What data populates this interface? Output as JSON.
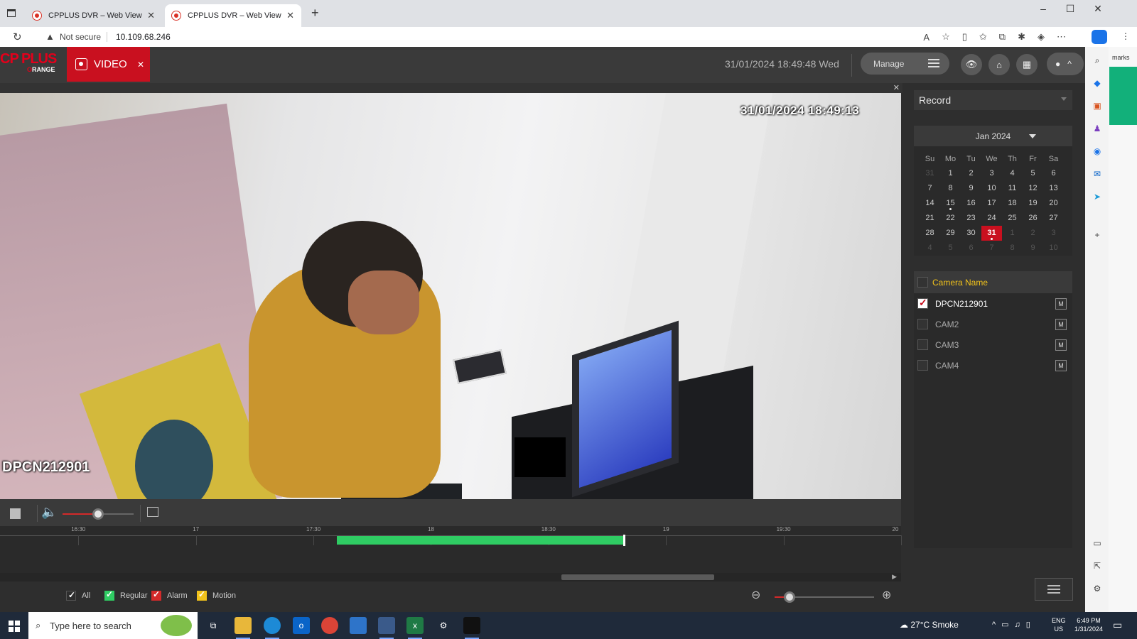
{
  "browser": {
    "tabs": [
      {
        "title": "CPPLUS DVR – Web View",
        "active": false
      },
      {
        "title": "CPPLUS DVR – Web View",
        "active": true
      }
    ],
    "security_label": "Not secure",
    "url": "10.109.68.246"
  },
  "app": {
    "brand": "CP PLUS",
    "sub_brand": "RANGE",
    "video_tab": "VIDEO",
    "datetime": "31/01/2024 18:49:48 Wed",
    "manage": "Manage"
  },
  "video": {
    "osd_timestamp": "31/01/2024 18:49:13",
    "osd_camera": "DPCN212901"
  },
  "playback": {
    "volume_level": 0.5,
    "timeline_ticks": [
      "16:30",
      "17",
      "17:30",
      "18",
      "18:30",
      "19",
      "19:30",
      "20"
    ],
    "record_range": [
      "17:36",
      "18:49"
    ],
    "cursor_time": "18:49",
    "legend": {
      "all": "All",
      "regular": "Regular",
      "alarm": "Alarm",
      "motion": "Motion"
    },
    "zoom_level": 0.15
  },
  "side": {
    "record_type": "Record",
    "calendar": {
      "month_label": "Jan 2024",
      "weekdays": [
        "Su",
        "Mo",
        "Tu",
        "We",
        "Th",
        "Fr",
        "Sa"
      ],
      "days": [
        [
          "31",
          "1",
          "2",
          "3",
          "4",
          "5",
          "6"
        ],
        [
          "7",
          "8",
          "9",
          "10",
          "11",
          "12",
          "13"
        ],
        [
          "14",
          "15",
          "16",
          "17",
          "18",
          "19",
          "20"
        ],
        [
          "21",
          "22",
          "23",
          "24",
          "25",
          "26",
          "27"
        ],
        [
          "28",
          "29",
          "30",
          "31",
          "1",
          "2",
          "3"
        ],
        [
          "4",
          "5",
          "6",
          "7",
          "8",
          "9",
          "10"
        ]
      ],
      "selected_day": "31",
      "days_with_records": [
        "15",
        "31"
      ]
    },
    "camera_header": "Camera Name",
    "cameras": [
      {
        "name": "DPCN212901",
        "checked": true,
        "mode": "M"
      },
      {
        "name": "CAM2",
        "checked": false,
        "mode": "M"
      },
      {
        "name": "CAM3",
        "checked": false,
        "mode": "M"
      },
      {
        "name": "CAM4",
        "checked": false,
        "mode": "M"
      }
    ]
  },
  "edge": {
    "partial_text": "marks"
  },
  "taskbar": {
    "search_placeholder": "Type here to search",
    "weather": "27°C  Smoke",
    "lang_top": "ENG",
    "lang_bottom": "US",
    "time": "6:49 PM",
    "date": "1/31/2024"
  },
  "colors": {
    "accent": "#c9101f",
    "record_green": "#2fcc63",
    "camera_header": "#f1c21b"
  }
}
